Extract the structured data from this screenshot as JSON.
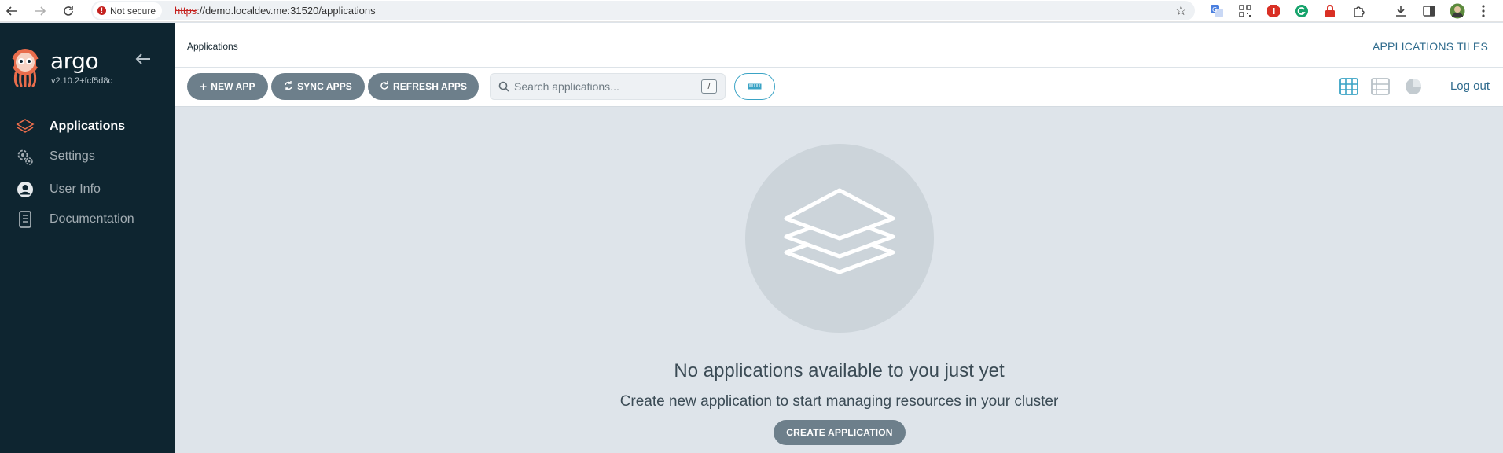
{
  "browser": {
    "security_label": "Not secure",
    "url_scheme": "https",
    "url_rest": "://demo.localdev.me:31520/applications",
    "icons": [
      "back-icon",
      "forward-icon",
      "reload-icon",
      "star-icon",
      "translate-extension-icon",
      "qr-extension-icon",
      "adblock-extension-icon",
      "grammarly-extension-icon",
      "lock-extension-icon",
      "extensions-icon",
      "download-icon",
      "side-panel-icon",
      "profile-avatar",
      "menu-icon"
    ]
  },
  "sidebar": {
    "brand": "argo",
    "version": "v2.10.2+fcf5d8c",
    "items": [
      {
        "label": "Applications",
        "icon": "layers-icon",
        "active": true
      },
      {
        "label": "Settings",
        "icon": "gears-icon",
        "active": false
      },
      {
        "label": "User Info",
        "icon": "user-circle-icon",
        "active": false
      },
      {
        "label": "Documentation",
        "icon": "book-icon",
        "active": false
      }
    ]
  },
  "header": {
    "title": "Applications",
    "view_title": "APPLICATIONS TILES"
  },
  "toolbar": {
    "new_app": "NEW APP",
    "sync_apps": "SYNC APPS",
    "refresh_apps": "REFRESH APPS",
    "search_placeholder": "Search applications...",
    "search_shortcut": "/",
    "logout": "Log out"
  },
  "empty_state": {
    "title": "No applications available to you just yet",
    "subtitle": "Create new application to start managing resources in your cluster",
    "button": "CREATE APPLICATION"
  },
  "colors": {
    "sidebar_bg": "#0e2530",
    "accent": "#3aa3c5",
    "button_bg": "#6d7f8b",
    "content_bg": "#dee4ea",
    "logo_orange": "#e96d4c"
  }
}
